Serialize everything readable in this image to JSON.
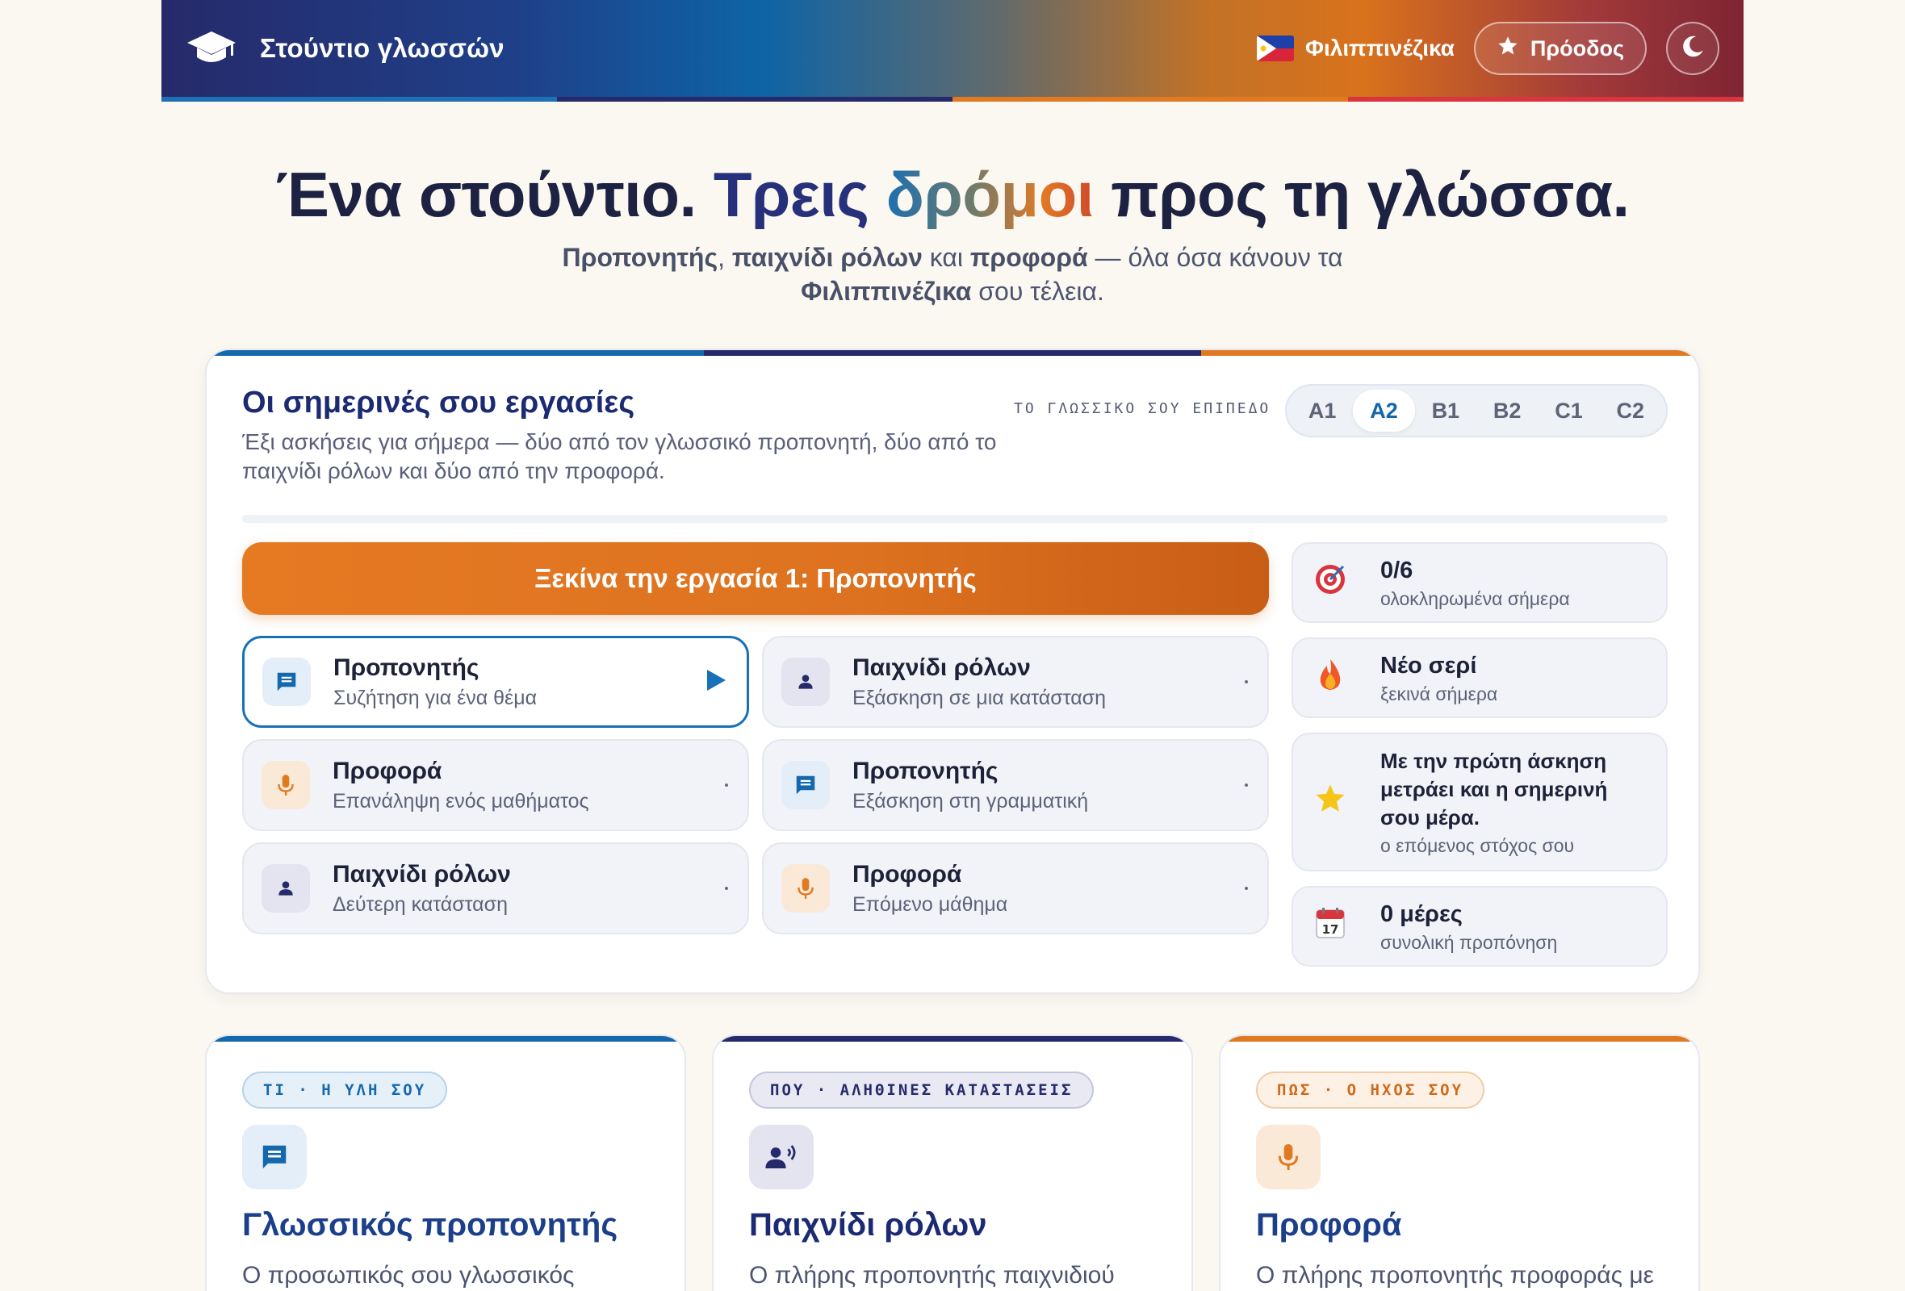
{
  "header": {
    "brand_title": "Στούντιο γλωσσών",
    "language_label": "Φιλιππινέζικα",
    "progress_label": "Πρόοδος",
    "strip_colors": [
      "#1f6fb5",
      "#262a6a",
      "#e07a22",
      "#d8353f"
    ]
  },
  "hero": {
    "title_part1": "Ένα στούντιο. ",
    "title_part2": "Τρεις ",
    "title_part3": "δρόμοι",
    "title_part4": " προς τη γλώσσα.",
    "sub_bold1": "Προπονητής",
    "sub_sep1": ", ",
    "sub_bold2": "παιχνίδι ρόλων",
    "sub_sep2": " και ",
    "sub_bold3": "προφορά",
    "sub_sep3": " — όλα όσα κάνουν τα",
    "sub_bold4": "Φιλιππινέζικα",
    "sub_sep4": " σου τέλεια."
  },
  "tasks": {
    "title": "Οι σημερινές σου εργασίες",
    "description": "Έξι ασκήσεις για σήμερα — δύο από τον γλωσσικό προπονητή, δύο από το παιχνίδι ρόλων και δύο από την προφορά.",
    "level_label": "ΤΟ ΓΛΩΣΣΙΚΟ ΣΟΥ ΕΠΙΠΕΔΟ",
    "levels": [
      "A1",
      "A2",
      "B1",
      "B2",
      "C1",
      "C2"
    ],
    "selected_level": "A2",
    "start_button": "Ξεκίνα την εργασία 1: Προπονητής",
    "exercises": [
      {
        "title": "Προπονητής",
        "subtitle": "Συζήτηση για ένα θέμα",
        "icon": "chat-icon",
        "active": true
      },
      {
        "title": "Παιχνίδι ρόλων",
        "subtitle": "Εξάσκηση σε μια κατάσταση",
        "icon": "person-icon"
      },
      {
        "title": "Προφορά",
        "subtitle": "Επανάληψη ενός μαθήματος",
        "icon": "microphone-icon"
      },
      {
        "title": "Προπονητής",
        "subtitle": "Εξάσκηση στη γραμματική",
        "icon": "chat-icon"
      },
      {
        "title": "Παιχνίδι ρόλων",
        "subtitle": "Δεύτερη κατάσταση",
        "icon": "person-icon"
      },
      {
        "title": "Προφορά",
        "subtitle": "Επόμενο μάθημα",
        "icon": "microphone-icon"
      }
    ],
    "stats": [
      {
        "icon": "target-icon",
        "main": "0/6",
        "sub": "ολοκληρωμένα σήμερα"
      },
      {
        "icon": "fire-icon",
        "main": "Νέο σερί",
        "sub": "ξεκινά σήμερα"
      },
      {
        "icon": "star-icon",
        "main": "Με την πρώτη άσκηση μετράει και η σημερινή σου μέρα.",
        "sub": "ο επόμενος στόχος σου"
      },
      {
        "icon": "calendar-icon",
        "main": "0 μέρες",
        "sub": "συνολική προπόνηση"
      }
    ]
  },
  "features": [
    {
      "badge": "ΤΙ · Η ΥΛΗ ΣΟΥ",
      "title": "Γλωσσικός προπονητής",
      "desc": "Ο προσωπικός σου γλωσσικός",
      "icon": "chat-icon",
      "color": "#1668ad"
    },
    {
      "badge": "ΠΟΥ · ΑΛΗΘΙΝΕΣ ΚΑΤΑΣΤΑΣΕΙΣ",
      "title": "Παιχνίδι ρόλων",
      "desc": "Ο πλήρης προπονητής παιχνιδιού",
      "icon": "voice-person-icon",
      "color": "#262a6a"
    },
    {
      "badge": "ΠΩΣ · Ο ΗΧΟΣ ΣΟΥ",
      "title": "Προφορά",
      "desc": "Ο πλήρης προπονητής προφοράς με",
      "icon": "microphone-icon",
      "color": "#e07a22"
    }
  ],
  "colors": {
    "blue": "#1668ad",
    "navy": "#262a6a",
    "orange": "#e07a22",
    "red": "#d8353f"
  }
}
